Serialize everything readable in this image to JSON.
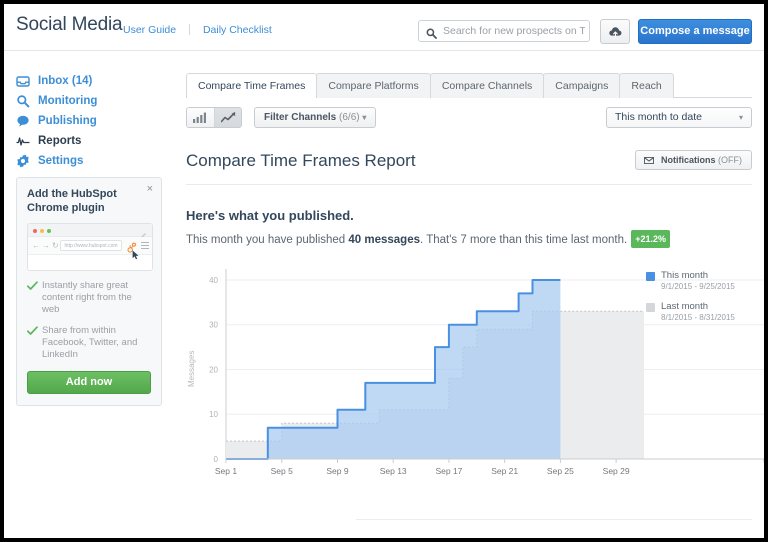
{
  "header": {
    "brand": "Social Media",
    "links": [
      {
        "label": "User Guide",
        "name": "user-guide"
      },
      {
        "label": "Daily Checklist",
        "name": "daily-checklist"
      }
    ],
    "search": {
      "placeholder": "Search for new prospects on Twitter",
      "value": "",
      "icon": "search-icon"
    },
    "upload_button": {
      "icon": "cloud-upload-icon"
    },
    "compose_button": {
      "label": "Compose a message"
    }
  },
  "sidebar": {
    "items": [
      {
        "label": "Inbox (14)",
        "icon": "inbox-icon",
        "active": false
      },
      {
        "label": "Monitoring",
        "icon": "search-icon",
        "active": false
      },
      {
        "label": "Publishing",
        "icon": "chat-bubble-icon",
        "active": false
      },
      {
        "label": "Reports",
        "icon": "pulse-icon",
        "active": true
      },
      {
        "label": "Settings",
        "icon": "gear-icon",
        "active": false
      }
    ],
    "promo": {
      "title": "Add the HubSpot Chrome plugin",
      "close_label": "×",
      "browser_mock": {
        "url": "http://www.hubspot.com"
      },
      "features": [
        "Instantly share great content right from the web",
        "Share from within Facebook, Twitter, and LinkedIn"
      ],
      "cta_label": "Add now"
    }
  },
  "main": {
    "tabs": [
      {
        "label": "Compare Time Frames",
        "active": true
      },
      {
        "label": "Compare Platforms",
        "active": false
      },
      {
        "label": "Compare Channels",
        "active": false
      },
      {
        "label": "Campaigns",
        "active": false
      },
      {
        "label": "Reach",
        "active": false
      }
    ],
    "toolbar": {
      "view_bar_label": "bar-chart-view",
      "view_line_label": "line-chart-view",
      "filter_label": "Filter Channels",
      "filter_count": "(6/6)",
      "filter_caret": "▾",
      "daterange_value": "This month to date",
      "daterange_caret": "▾"
    },
    "page_title": "Compare Time Frames Report",
    "notifications": {
      "icon": "envelope-icon",
      "label": "Notifications",
      "state": "(OFF)"
    },
    "section_heading": "Here's what you published.",
    "summary": {
      "pre": "This month you have published ",
      "strong": "40 messages",
      "post": ". That's 7 more than this time last month.",
      "badge": "+21.2%"
    }
  },
  "chart_data": {
    "type": "area",
    "title": "",
    "xlabel": "",
    "ylabel": "Messages",
    "ylim": [
      0,
      42
    ],
    "yticks": [
      0,
      10,
      20,
      30,
      40
    ],
    "xticks": [
      "Sep 1",
      "Sep 5",
      "Sep 9",
      "Sep 13",
      "Sep 17",
      "Sep 21",
      "Sep 25",
      "Sep 29"
    ],
    "x_domain": [
      1,
      31
    ],
    "grid": true,
    "legend_position": "right",
    "step": true,
    "series": [
      {
        "name": "This month",
        "dates": "9/1/2015 - 9/25/2015",
        "color": "#4a90e2",
        "fill": "#a9cbf0",
        "x": [
          1,
          2,
          3,
          4,
          5,
          6,
          7,
          8,
          9,
          10,
          11,
          12,
          13,
          14,
          15,
          16,
          17,
          18,
          19,
          20,
          21,
          22,
          23,
          24,
          25
        ],
        "values": [
          0,
          0,
          0,
          7,
          7,
          7,
          7,
          7,
          11,
          11,
          17,
          17,
          17,
          17,
          17,
          25,
          30,
          30,
          33,
          33,
          33,
          37,
          40,
          40,
          40
        ]
      },
      {
        "name": "Last month",
        "dates": "8/1/2015 - 8/31/2015",
        "color": "#bfc3c7",
        "fill": "#ebecee",
        "x": [
          1,
          2,
          3,
          4,
          5,
          6,
          7,
          8,
          9,
          10,
          11,
          12,
          13,
          14,
          15,
          16,
          17,
          18,
          19,
          20,
          21,
          22,
          23,
          24,
          25,
          26,
          27,
          28,
          29,
          30,
          31
        ],
        "values": [
          4,
          4,
          4,
          4,
          8,
          8,
          8,
          8,
          8,
          8,
          8,
          11,
          11,
          11,
          11,
          11,
          18,
          25,
          29,
          29,
          29,
          29,
          33,
          33,
          33,
          33,
          33,
          33,
          33,
          33,
          33
        ]
      }
    ]
  },
  "colors": {
    "accent_blue": "#3c8ed6",
    "compose_blue": "#2b74cc",
    "this_month": "#4a90e2",
    "last_month": "#d9dbde",
    "badge_green": "#5bb75b",
    "cta_green": "#53a84c"
  }
}
